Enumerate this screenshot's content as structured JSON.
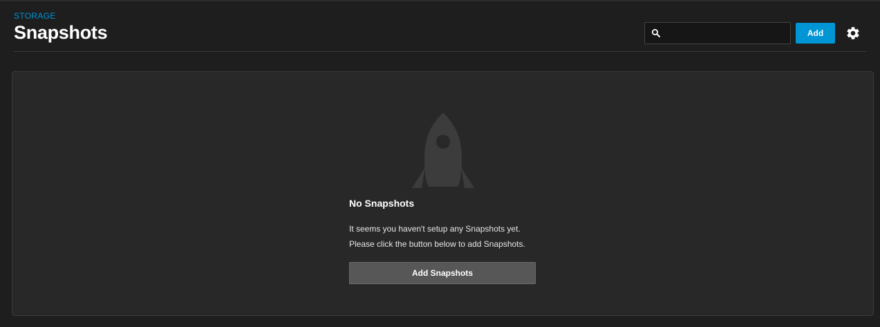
{
  "header": {
    "breadcrumb": "STORAGE",
    "title": "Snapshots",
    "search": {
      "value": "",
      "placeholder": "",
      "icon": "search-icon"
    },
    "add_label": "Add",
    "settings_icon": "gear-icon"
  },
  "empty_state": {
    "icon": "rocket-icon",
    "title": "No Snapshots",
    "message_line1": "It seems you haven't setup any Snapshots yet.",
    "message_line2": "Please click the button below to add Snapshots.",
    "button_label": "Add Snapshots"
  },
  "colors": {
    "background": "#1e1e1e",
    "card": "#282828",
    "accent": "#0095d5",
    "icon_muted": "#3c3c3c",
    "secondary_button": "#575757"
  }
}
